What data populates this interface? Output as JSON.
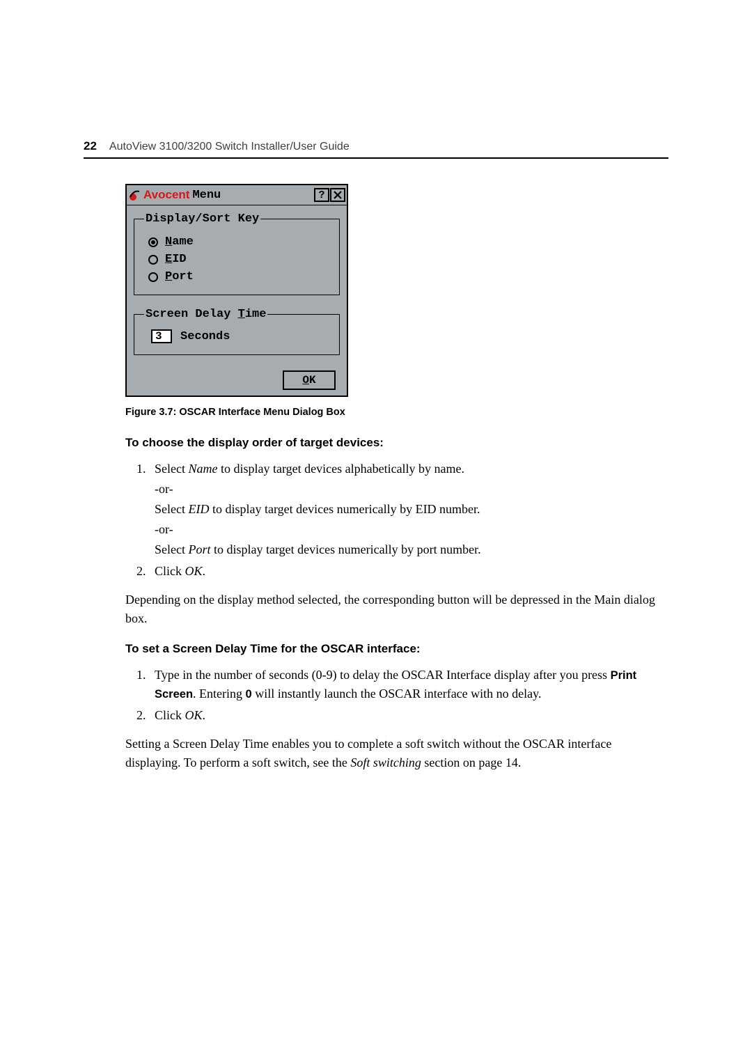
{
  "header": {
    "page_number": "22",
    "guide_title": "AutoView 3100/3200 Switch Installer/User Guide"
  },
  "dialog": {
    "brand": "Avocent",
    "title": "Menu",
    "help_btn": "?",
    "close_btn": "✕",
    "group_sort": {
      "legend": "Display/Sort Key",
      "options": {
        "name": {
          "label_pre": "N",
          "label_rest": "ame",
          "selected": true
        },
        "eid": {
          "label_pre": "E",
          "label_rest": "ID",
          "selected": false
        },
        "port": {
          "label_pre": "P",
          "label_rest": "ort",
          "selected": false
        }
      }
    },
    "group_delay": {
      "legend_pre": "Screen Delay ",
      "legend_mn": "T",
      "legend_rest": "ime",
      "value": "3",
      "unit": "Seconds"
    },
    "ok_mn": "O",
    "ok_rest": "K"
  },
  "caption": "Figure 3.7: OSCAR Interface Menu Dialog Box",
  "section1": {
    "heading": "To choose the display order of target devices:",
    "step1_a": "Select ",
    "step1_b": "Name",
    "step1_c": " to display target devices alphabetically by name.",
    "or": "-or-",
    "step1_d": "Select ",
    "step1_e": "EID",
    "step1_f": " to display target devices numerically by EID number.",
    "step1_g": "Select ",
    "step1_h": "Port",
    "step1_i": " to display target devices numerically by port number.",
    "step2_a": "Click ",
    "step2_b": "OK",
    "step2_c": "."
  },
  "para1": "Depending on the display method selected, the corresponding button will be depressed in the Main dialog box.",
  "section2": {
    "heading": "To set a Screen Delay Time for the OSCAR interface:",
    "step1_a": "Type in the number of seconds (0-9) to delay the OSCAR Interface display after you press ",
    "step1_b": "Print Screen",
    "step1_c": ". Entering ",
    "step1_d": "0",
    "step1_e": " will instantly launch the OSCAR interface with no delay.",
    "step2_a": "Click ",
    "step2_b": "OK",
    "step2_c": "."
  },
  "para2_a": "Setting a Screen Delay Time enables you to complete a soft switch without the OSCAR interface displaying. To perform a soft switch, see the ",
  "para2_b": "Soft switching",
  "para2_c": " section on page 14."
}
